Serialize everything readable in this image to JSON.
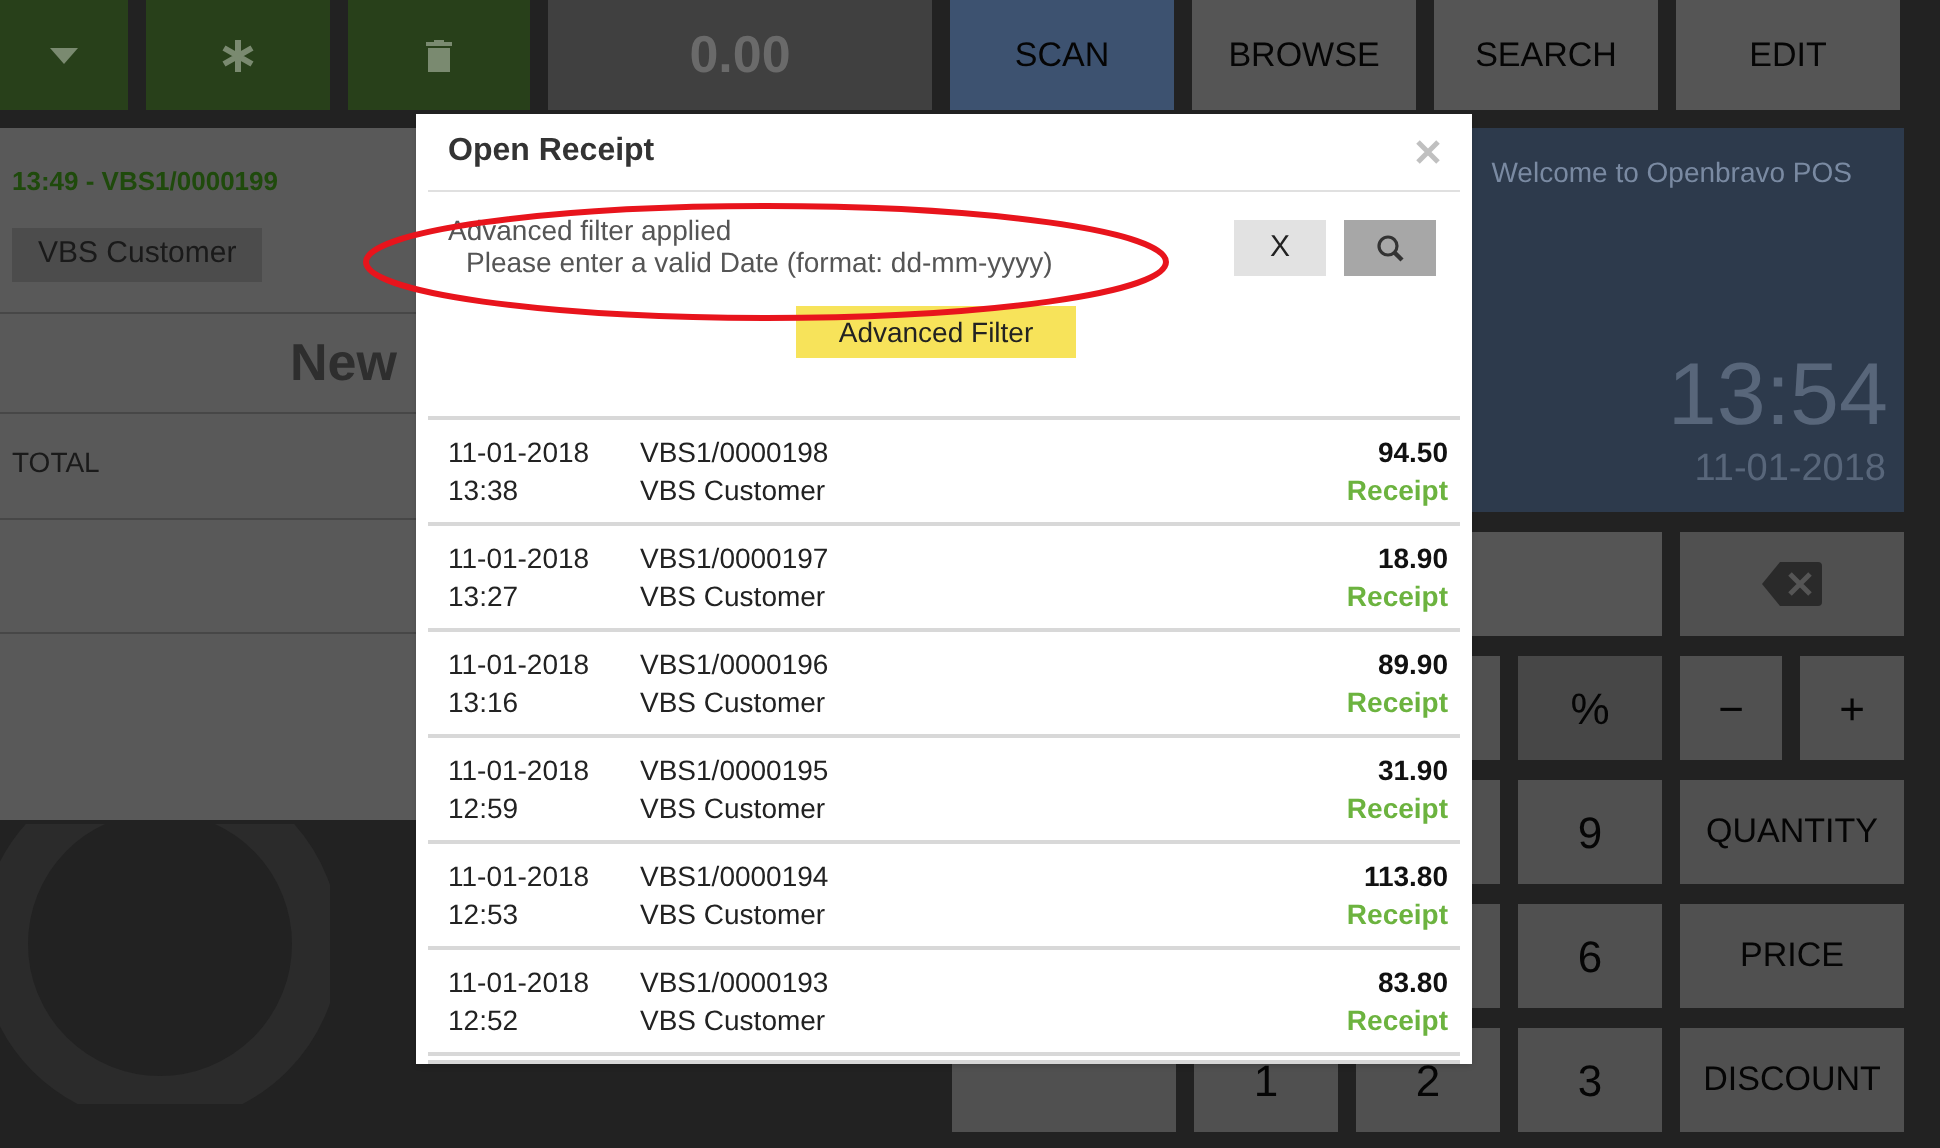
{
  "toolbar": {
    "amount": "0.00",
    "actions": [
      {
        "label": "SCAN",
        "selected": true
      },
      {
        "label": "BROWSE",
        "selected": false
      },
      {
        "label": "SEARCH",
        "selected": false
      },
      {
        "label": "EDIT",
        "selected": false
      }
    ]
  },
  "receipt": {
    "header": "13:49 - VBS1/0000199",
    "customer": "VBS Customer",
    "title": "New",
    "total_label": "TOTAL"
  },
  "welcome": {
    "message": "Welcome to Openbravo POS",
    "time": "13:54",
    "date": "11-01-2018"
  },
  "keypad": [
    {
      "kind": "display"
    },
    {
      "kind": "backspace"
    },
    {
      "kind": "blank"
    },
    {
      "kind": "blank"
    },
    {
      "kind": "blank"
    },
    {
      "kind": "operator",
      "label": "%"
    },
    {
      "kind": "sign",
      "label": "−"
    },
    {
      "kind": "sign",
      "label": "+"
    },
    {
      "kind": "blank"
    },
    {
      "kind": "blank"
    },
    {
      "kind": "blank"
    },
    {
      "kind": "digit",
      "label": "9"
    },
    {
      "kind": "function",
      "label": "QUANTITY"
    },
    {
      "kind": "blank"
    },
    {
      "kind": "blank"
    },
    {
      "kind": "blank"
    },
    {
      "kind": "digit",
      "label": "6"
    },
    {
      "kind": "function",
      "label": "PRICE"
    },
    {
      "kind": "blank"
    },
    {
      "kind": "digit",
      "label": "1"
    },
    {
      "kind": "digit",
      "label": "2"
    },
    {
      "kind": "digit",
      "label": "3"
    },
    {
      "kind": "function",
      "label": "DISCOUNT"
    }
  ],
  "dialog": {
    "title": "Open Receipt",
    "filter_status": "Advanced filter applied",
    "filter_error": "Please enter a valid Date (format: dd-mm-yyyy)",
    "clear_label": "X",
    "advanced_filter_label": "Advanced Filter",
    "rows": [
      {
        "date": "11-01-2018",
        "time": "13:38",
        "number": "VBS1/0000198",
        "customer": "VBS Customer",
        "amount": "94.50",
        "type": "Receipt"
      },
      {
        "date": "11-01-2018",
        "time": "13:27",
        "number": "VBS1/0000197",
        "customer": "VBS Customer",
        "amount": "18.90",
        "type": "Receipt"
      },
      {
        "date": "11-01-2018",
        "time": "13:16",
        "number": "VBS1/0000196",
        "customer": "VBS Customer",
        "amount": "89.90",
        "type": "Receipt"
      },
      {
        "date": "11-01-2018",
        "time": "12:59",
        "number": "VBS1/0000195",
        "customer": "VBS Customer",
        "amount": "31.90",
        "type": "Receipt"
      },
      {
        "date": "11-01-2018",
        "time": "12:53",
        "number": "VBS1/0000194",
        "customer": "VBS Customer",
        "amount": "113.80",
        "type": "Receipt"
      },
      {
        "date": "11-01-2018",
        "time": "12:52",
        "number": "VBS1/0000193",
        "customer": "VBS Customer",
        "amount": "83.80",
        "type": "Receipt"
      }
    ]
  }
}
